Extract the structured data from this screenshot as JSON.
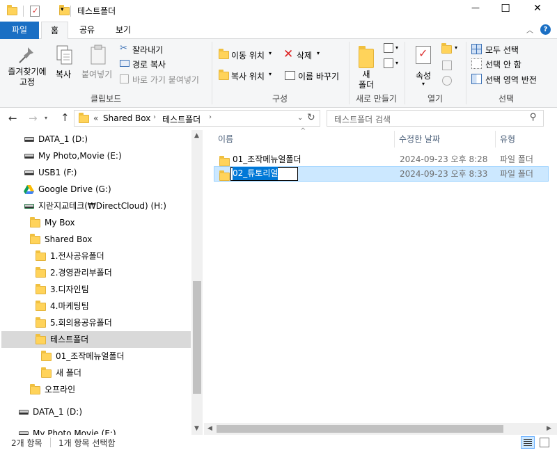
{
  "window": {
    "title": "테스트폴더",
    "controls": {
      "minimize": "—",
      "maximize": "☐",
      "close": "✕"
    }
  },
  "ribbon_tabs": [
    {
      "label": "파일"
    },
    {
      "label": "홈"
    },
    {
      "label": "공유"
    },
    {
      "label": "보기"
    }
  ],
  "ribbon": {
    "clipboard": {
      "pin": "즐겨찾기에\n고정",
      "copy": "복사",
      "paste": "붙여넣기",
      "cut": "잘라내기",
      "copy_path": "경로 복사",
      "paste_shortcut": "바로 가기 붙여넣기",
      "group": "클립보드"
    },
    "organize": {
      "move_to": "이동 위치",
      "copy_to": "복사 위치",
      "delete": "삭제",
      "rename": "이름 바꾸기",
      "group": "구성"
    },
    "new": {
      "new_folder": "새\n폴더",
      "group": "새로 만들기"
    },
    "open": {
      "properties": "속성",
      "group": "열기"
    },
    "select": {
      "select_all": "모두 선택",
      "select_none": "선택 안 함",
      "invert": "선택 영역 반전",
      "group": "선택"
    }
  },
  "address": {
    "prefix": "«",
    "crumbs": [
      "Shared Box",
      "테스트폴더"
    ],
    "search_placeholder": "테스트폴더 검색"
  },
  "nav_tree": [
    {
      "label": "DATA_1 (D:)",
      "icon": "drive"
    },
    {
      "label": "My Photo,Movie (E:)",
      "icon": "drive"
    },
    {
      "label": "USB1 (F:)",
      "icon": "drive"
    },
    {
      "label": "Google Drive (G:)",
      "icon": "gdrive"
    },
    {
      "label": "지란지교테크(₩DirectCloud) (H:)",
      "icon": "netdrive"
    },
    {
      "label": "My Box",
      "icon": "folder"
    },
    {
      "label": "Shared Box",
      "icon": "folder"
    },
    {
      "label": "1.전사공유폴더",
      "icon": "folder"
    },
    {
      "label": "2.경영관리부폴더",
      "icon": "folder"
    },
    {
      "label": "3.디자인팀",
      "icon": "folder"
    },
    {
      "label": "4.마케팅팀",
      "icon": "folder"
    },
    {
      "label": "5.회의용공유폴더",
      "icon": "folder"
    },
    {
      "label": "테스트폴더",
      "icon": "folder",
      "selected": true
    },
    {
      "label": "01_조작메뉴얼폴더",
      "icon": "folder"
    },
    {
      "label": "새 폴더",
      "icon": "folder"
    },
    {
      "label": "오프라인",
      "icon": "folder"
    },
    {
      "label": "DATA_1 (D:)",
      "icon": "drive"
    },
    {
      "label": "My Photo,Movie (E:)",
      "icon": "drive"
    }
  ],
  "columns": {
    "name": "이름",
    "modified": "수정한 날짜",
    "type": "유형"
  },
  "files": [
    {
      "name": "01_조작메뉴얼폴더",
      "modified": "2024-09-23 오후 8:28",
      "type": "파일 폴더"
    },
    {
      "name": "02_튜토리얼",
      "modified": "2024-09-23 오후 8:33",
      "type": "파일 폴더",
      "renaming": true
    }
  ],
  "status": {
    "count": "2개 항목",
    "selected": "1개 항목 선택함"
  }
}
